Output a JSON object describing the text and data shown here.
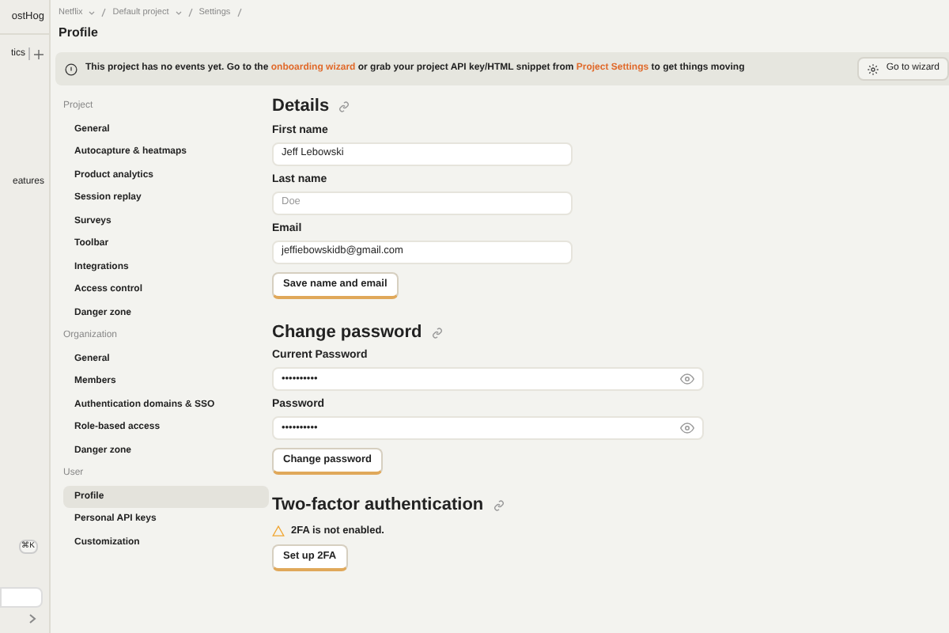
{
  "app_sidebar": {
    "brand": "ostHog",
    "items": [
      {
        "label": "tics",
        "kind": "add"
      },
      {
        "label": "eatures",
        "kind": "plain"
      }
    ],
    "shortcut": "⌘K"
  },
  "breadcrumbs": [
    "Netflix",
    "Default project",
    "Settings"
  ],
  "page_title": "Profile",
  "banner": {
    "text_before": "This project has no events yet. Go to the ",
    "link_1": "onboarding wizard",
    "text_middle": " or grab your project API key/HTML snippet from ",
    "link_2": "Project Settings",
    "text_after": " to get things moving",
    "button": "Go to wizard"
  },
  "settings_nav": [
    {
      "heading": "Project",
      "items": [
        {
          "label": "General",
          "selected": false
        },
        {
          "label": "Autocapture & heatmaps",
          "selected": false
        },
        {
          "label": "Product analytics",
          "selected": false
        },
        {
          "label": "Session replay",
          "selected": false
        },
        {
          "label": "Surveys",
          "selected": false
        },
        {
          "label": "Toolbar",
          "selected": false
        },
        {
          "label": "Integrations",
          "selected": false
        },
        {
          "label": "Access control",
          "selected": false
        },
        {
          "label": "Danger zone",
          "selected": false
        }
      ]
    },
    {
      "heading": "Organization",
      "items": [
        {
          "label": "General",
          "selected": false
        },
        {
          "label": "Members",
          "selected": false
        },
        {
          "label": "Authentication domains & SSO",
          "selected": false
        },
        {
          "label": "Role-based access",
          "selected": false
        },
        {
          "label": "Danger zone",
          "selected": false
        }
      ]
    },
    {
      "heading": "User",
      "items": [
        {
          "label": "Profile",
          "selected": true
        },
        {
          "label": "Personal API keys",
          "selected": false
        },
        {
          "label": "Customization",
          "selected": false
        }
      ]
    }
  ],
  "details": {
    "title": "Details",
    "fields": [
      {
        "label": "First name",
        "value": "Jeff Lebowski"
      },
      {
        "label": "Last name",
        "placeholder": "Doe"
      },
      {
        "label": "Email",
        "value": "jeffiebowskidb@gmail.com"
      }
    ],
    "button": "Save name and email"
  },
  "change_password": {
    "title": "Change password",
    "fields": [
      {
        "label": "Current Password",
        "value": "••••••••••"
      },
      {
        "label": "Password",
        "value": "••••••••••"
      }
    ],
    "button": "Change password"
  },
  "two_factor": {
    "title": "Two-factor authentication",
    "warning": "2FA is not enabled.",
    "button": "Set up 2FA"
  }
}
